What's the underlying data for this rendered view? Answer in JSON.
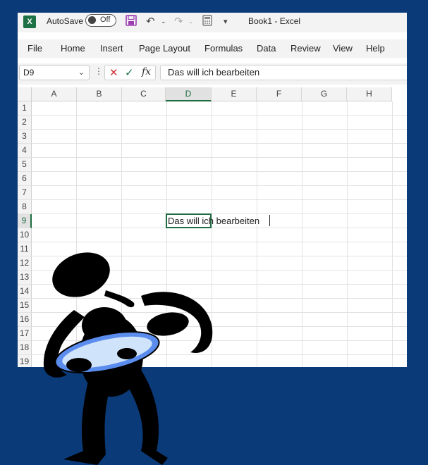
{
  "titlebar": {
    "logo_letter": "X",
    "autosave_label": "AutoSave",
    "toggle_state": "Off",
    "title": "Book1  -  Excel",
    "icons": [
      "save-icon",
      "undo-icon",
      "redo-icon",
      "calculator-icon",
      "customize-icon"
    ]
  },
  "ribbon": {
    "tabs": [
      "File",
      "Home",
      "Insert",
      "Page Layout",
      "Formulas",
      "Data",
      "Review",
      "View",
      "Help"
    ]
  },
  "formula_bar": {
    "name_box": "D9",
    "formula": "Das will ich bearbeiten",
    "fx_label": "fx"
  },
  "sheet": {
    "columns": [
      "A",
      "B",
      "C",
      "D",
      "E",
      "F",
      "G",
      "H"
    ],
    "rows": [
      "1",
      "2",
      "3",
      "4",
      "5",
      "6",
      "7",
      "8",
      "9",
      "10",
      "11",
      "12",
      "13",
      "14",
      "15",
      "16",
      "17",
      "18",
      "19"
    ],
    "active_column": "D",
    "active_row": "9",
    "active_cell_text": "Das will ich bearbeiten"
  },
  "colors": {
    "background": "#0a3a78",
    "excel_green": "#1e7145",
    "selection_green": "#1e6c41",
    "magnifier_rim": "#5b8def"
  }
}
